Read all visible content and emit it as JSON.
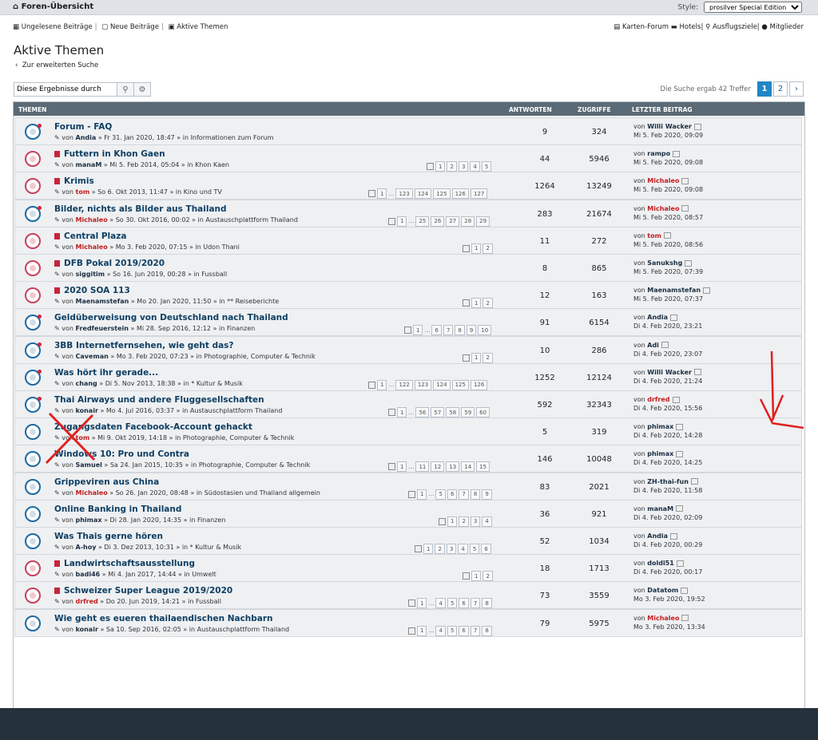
{
  "topbar": {
    "home": "Foren-Übersicht",
    "style_label": "Style:",
    "style_value": "prosilver Special Edition"
  },
  "nav": {
    "unread": "Ungelesene Beiträge",
    "new": "Neue Beiträge",
    "active": "Aktive Themen",
    "map": "Karten-Forum",
    "hotels": "Hotels",
    "trips": "Ausflugsziele",
    "members": "Mitglieder"
  },
  "title": "Aktive Themen",
  "back": "Zur erweiterten Suche",
  "search": {
    "value": "Diese Ergebnisse durch"
  },
  "result_info": "Die Suche ergab 42 Treffer",
  "pagination": [
    "1",
    "2"
  ],
  "headers": {
    "topics": "THEMEN",
    "answers": "ANTWORTEN",
    "views": "ZUGRIFFE",
    "last": "LETZTER BEITRAG"
  },
  "rows": [
    {
      "title": "Forum - FAQ",
      "by": "von",
      "user": "Andia",
      "date": "» Fr 31. Jan 2020, 18:47 » in",
      "forum": "Informationen zum Forum",
      "answers": "9",
      "views": "324",
      "last_user": "Willi Wacker",
      "last_date": "Mi 5. Feb 2020, 09:09",
      "pages": []
    },
    {
      "title": "Futtern in Khon Gaen",
      "by": "von",
      "user": "manaM",
      "date": "» Mi 5. Feb 2014, 05:04 » in",
      "forum": "Khon Kaen",
      "answers": "44",
      "views": "5946",
      "last_user": "rampo",
      "last_date": "Mi 5. Feb 2020, 09:08",
      "pages": [
        "1",
        "2",
        "3",
        "4",
        "5"
      ]
    },
    {
      "title": "Krimis",
      "by": "von",
      "user": "tom",
      "date": "» So 6. Okt 2013, 11:47 » in",
      "forum": "Kino und TV",
      "answers": "1264",
      "views": "13249",
      "last_user": "Michaleo",
      "last_date": "Mi 5. Feb 2020, 09:08",
      "pages": [
        "1",
        "…",
        "123",
        "124",
        "125",
        "126",
        "127"
      ]
    },
    {
      "title": "Bilder, nichts als Bilder aus Thailand",
      "by": "von",
      "user": "Michaleo",
      "date": "» So 30. Okt 2016, 00:02 » in",
      "forum": "Austauschplattform Thailand",
      "answers": "283",
      "views": "21674",
      "last_user": "Michaleo",
      "last_date": "Mi 5. Feb 2020, 08:57",
      "pages": [
        "1",
        "…",
        "25",
        "26",
        "27",
        "28",
        "29"
      ]
    },
    {
      "title": "Central Plaza",
      "by": "von",
      "user": "Michaleo",
      "date": "» Mo 3. Feb 2020, 07:15 » in",
      "forum": "Udon Thani",
      "answers": "11",
      "views": "272",
      "last_user": "tom",
      "last_date": "Mi 5. Feb 2020, 08:56",
      "pages": [
        "1",
        "2"
      ]
    },
    {
      "title": "DFB Pokal 2019/2020",
      "by": "von",
      "user": "siggitim",
      "date": "» So 16. Jun 2019, 00:28 » in",
      "forum": "Fussball",
      "answers": "8",
      "views": "865",
      "last_user": "Sanukshg",
      "last_date": "Mi 5. Feb 2020, 07:39",
      "pages": []
    },
    {
      "title": "2020 SOA 113",
      "by": "von",
      "user": "Maenamstefan",
      "date": "» Mo 20. Jan 2020, 11:50 » in",
      "forum": "** Reiseberichte",
      "answers": "12",
      "views": "163",
      "last_user": "Maenamstefan",
      "last_date": "Mi 5. Feb 2020, 07:37",
      "pages": [
        "1",
        "2"
      ]
    },
    {
      "title": "Geldüberweisung von Deutschland nach Thailand",
      "by": "von",
      "user": "Fredfeuerstein",
      "date": "» Mi 28. Sep 2016, 12:12 » in",
      "forum": "Finanzen",
      "answers": "91",
      "views": "6154",
      "last_user": "Andia",
      "last_date": "Di 4. Feb 2020, 23:21",
      "pages": [
        "1",
        "…",
        "6",
        "7",
        "8",
        "9",
        "10"
      ]
    },
    {
      "title": "3BB Internetfernsehen, wie geht das?",
      "by": "von",
      "user": "Caveman",
      "date": "» Mo 3. Feb 2020, 07:23 » in",
      "forum": "Photographie, Computer & Technik",
      "answers": "10",
      "views": "286",
      "last_user": "Adi",
      "last_date": "Di 4. Feb 2020, 23:07",
      "pages": [
        "1",
        "2"
      ]
    },
    {
      "title": "Was hört ihr gerade...",
      "by": "von",
      "user": "chang",
      "date": "» Di 5. Nov 2013, 18:38 » in",
      "forum": "* Kultur & Musik",
      "answers": "1252",
      "views": "12124",
      "last_user": "Willi Wacker",
      "last_date": "Di 4. Feb 2020, 21:24",
      "pages": [
        "1",
        "…",
        "122",
        "123",
        "124",
        "125",
        "126"
      ]
    },
    {
      "title": "Thai Airways und andere Fluggesellschaften",
      "by": "von",
      "user": "konair",
      "date": "» Mo 4. Jul 2016, 03:37 » in",
      "forum": "Austauschplattform Thailand",
      "answers": "592",
      "views": "32343",
      "last_user": "drfred",
      "last_date": "Di 4. Feb 2020, 15:56",
      "pages": [
        "1",
        "…",
        "56",
        "57",
        "58",
        "59",
        "60"
      ]
    },
    {
      "title": "Zugangsdaten Facebook-Account gehackt",
      "by": "von",
      "user": "tom",
      "date": "» Mi 9. Okt 2019, 14:18 » in",
      "forum": "Photographie, Computer & Technik",
      "answers": "5",
      "views": "319",
      "last_user": "phimax",
      "last_date": "Di 4. Feb 2020, 14:28",
      "pages": []
    },
    {
      "title": "Windows 10: Pro und Contra",
      "by": "von",
      "user": "Samuel",
      "date": "» Sa 24. Jan 2015, 10:35 » in",
      "forum": "Photographie, Computer & Technik",
      "answers": "146",
      "views": "10048",
      "last_user": "phimax",
      "last_date": "Di 4. Feb 2020, 14:25",
      "pages": [
        "1",
        "…",
        "11",
        "12",
        "13",
        "14",
        "15"
      ]
    },
    {
      "title": "Grippeviren aus China",
      "by": "von",
      "user": "Michaleo",
      "date": "» So 26. Jan 2020, 08:48 » in",
      "forum": "Südostasien und Thailand allgemein",
      "answers": "83",
      "views": "2021",
      "last_user": "ZH-thai-fun",
      "last_date": "Di 4. Feb 2020, 11:58",
      "pages": [
        "1",
        "…",
        "5",
        "6",
        "7",
        "8",
        "9"
      ]
    },
    {
      "title": "Online Banking in Thailand",
      "by": "von",
      "user": "phimax",
      "date": "» Di 28. Jan 2020, 14:35 » in",
      "forum": "Finanzen",
      "answers": "36",
      "views": "921",
      "last_user": "manaM",
      "last_date": "Di 4. Feb 2020, 02:09",
      "pages": [
        "1",
        "2",
        "3",
        "4"
      ]
    },
    {
      "title": "Was Thais gerne hören",
      "by": "von",
      "user": "A-hoy",
      "date": "» Di 3. Dez 2013, 10:31 » in",
      "forum": "* Kultur & Musik",
      "answers": "52",
      "views": "1034",
      "last_user": "Andia",
      "last_date": "Di 4. Feb 2020, 00:29",
      "pages": [
        "1",
        "2",
        "3",
        "4",
        "5",
        "6"
      ]
    },
    {
      "title": "Landwirtschaftsausstellung",
      "by": "von",
      "user": "badi46",
      "date": "» Mi 4. Jan 2017, 14:44 » in",
      "forum": "Umwelt",
      "answers": "18",
      "views": "1713",
      "last_user": "doldi51",
      "last_date": "Di 4. Feb 2020, 00:17",
      "pages": [
        "1",
        "2"
      ]
    },
    {
      "title": "Schweizer Super League 2019/2020",
      "by": "von",
      "user": "drfred",
      "date": "» Do 20. Jun 2019, 14:21 » in",
      "forum": "Fussball",
      "answers": "73",
      "views": "3559",
      "last_user": "Datatom",
      "last_date": "Mo 3. Feb 2020, 19:52",
      "pages": [
        "1",
        "…",
        "4",
        "5",
        "6",
        "7",
        "8"
      ]
    },
    {
      "title": "Wie geht es eueren thailaendischen Nachbarn",
      "by": "von",
      "user": "konair",
      "date": "» Sa 10. Sep 2016, 02:05 » in",
      "forum": "Austauschplattform Thailand",
      "answers": "79",
      "views": "5975",
      "last_user": "Michaleo",
      "last_date": "Mo 3. Feb 2020, 13:34",
      "pages": [
        "1",
        "…",
        "4",
        "5",
        "6",
        "7",
        "8"
      ]
    }
  ]
}
